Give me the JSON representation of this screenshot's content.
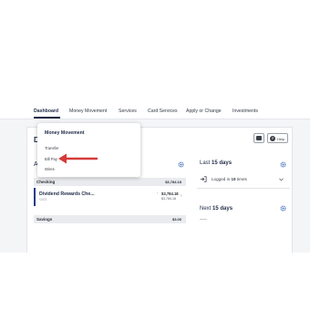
{
  "nav": {
    "items": [
      "Dashboard",
      "Money Movement",
      "Services",
      "Card Services",
      "Apply or Change",
      "Investments"
    ]
  },
  "header": {
    "page_title_initial": "D",
    "help_label": "Help"
  },
  "accounts": {
    "section_initial": "A",
    "checking_label": "Checking",
    "checking_total": "$3,784.18",
    "account_name": "Dividend Rewards Che...",
    "account_number": "*2473",
    "account_balance": "$3,784.18",
    "account_available": "$3,784.18",
    "savings_label": "Savings",
    "savings_total": "$3.00"
  },
  "activity": {
    "last_label_prefix": "Last ",
    "last_label_bold": "15 days",
    "logged_in_prefix": "Logged in ",
    "logged_in_count": "19",
    "logged_in_suffix": " times",
    "next_label_prefix": "Next ",
    "next_label_bold": "15 days"
  },
  "dropdown": {
    "title": "Money Movement",
    "items": [
      "Transfer",
      "Bill Pay",
      "Wires"
    ]
  },
  "colors": {
    "accent": "#1e3a8a",
    "arrow": "#d63a3a",
    "gear": "#2f5fb3"
  }
}
